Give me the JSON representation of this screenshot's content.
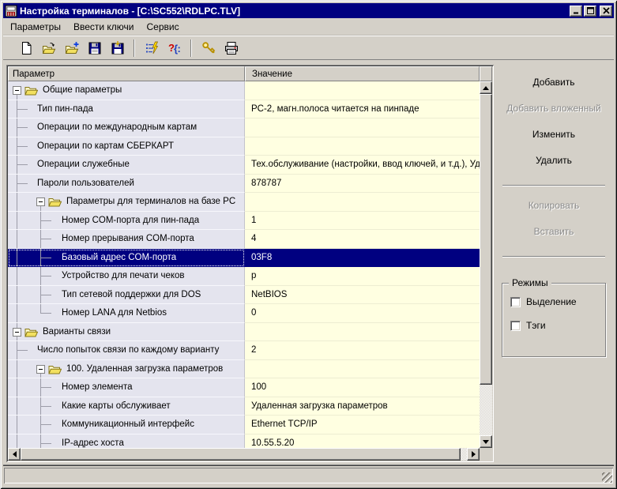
{
  "window": {
    "title": "Настройка терминалов - [C:\\SC552\\RDLPC.TLV]"
  },
  "menu": {
    "items": [
      "Параметры",
      "Ввести ключи",
      "Сервис"
    ]
  },
  "toolbar": {
    "buttons": [
      "new-file",
      "open-file",
      "open-file-add",
      "save-file",
      "save-file-as",
      "check-parameters",
      "syntax-help",
      "enter-keys",
      "print-device"
    ]
  },
  "table": {
    "columns": [
      "Параметр",
      "Значение"
    ],
    "rows": [
      {
        "label": "Общие параметры",
        "value": "",
        "kind": "folder",
        "pad": 44,
        "box": 6,
        "guides": [
          {
            "l": 11,
            "h": "bottom"
          }
        ]
      },
      {
        "label": "Тип пин-пада",
        "value": "PC-2, магн.полоса читается на пинпаде",
        "kind": "leaf",
        "pad": 37,
        "guides": [
          {
            "l": 11
          }
        ],
        "tick": 11
      },
      {
        "label": "Операции по международным картам",
        "value": "",
        "kind": "leaf",
        "pad": 37,
        "guides": [
          {
            "l": 11
          }
        ],
        "tick": 11
      },
      {
        "label": "Операции по картам СБЕРКАРТ",
        "value": "",
        "kind": "leaf",
        "pad": 37,
        "guides": [
          {
            "l": 11
          }
        ],
        "tick": 11
      },
      {
        "label": "Операции служебные",
        "value": "Тех.обслуживание (настройки, ввод ключей, и т.д.), Уд...",
        "kind": "leaf",
        "pad": 37,
        "guides": [
          {
            "l": 11
          }
        ],
        "tick": 11
      },
      {
        "label": "Пароли пользователей",
        "value": "878787",
        "kind": "leaf",
        "pad": 37,
        "guides": [
          {
            "l": 11
          }
        ],
        "tick": 11
      },
      {
        "label": "Параметры для терминалов на базе PC",
        "value": "",
        "kind": "folder",
        "pad": 74,
        "box": 36,
        "guides": [
          {
            "l": 11
          },
          {
            "l": 41,
            "h": "bottom"
          }
        ]
      },
      {
        "label": "Номер COM-порта для пин-пада",
        "value": "1",
        "kind": "leaf",
        "pad": 68,
        "guides": [
          {
            "l": 11
          },
          {
            "l": 41
          }
        ],
        "tick": 41
      },
      {
        "label": "Номер прерывания COM-порта",
        "value": "4",
        "kind": "leaf",
        "pad": 68,
        "guides": [
          {
            "l": 11
          },
          {
            "l": 41
          }
        ],
        "tick": 41
      },
      {
        "label": "Базовый адрес COM-порта",
        "value": "03F8",
        "kind": "leaf",
        "pad": 68,
        "guides": [
          {
            "l": 11
          },
          {
            "l": 41
          }
        ],
        "tick": 41,
        "selected": true
      },
      {
        "label": "Устройство для печати чеков",
        "value": "p",
        "kind": "leaf",
        "pad": 68,
        "guides": [
          {
            "l": 11
          },
          {
            "l": 41
          }
        ],
        "tick": 41
      },
      {
        "label": "Тип сетевой поддержки для DOS",
        "value": "NetBIOS",
        "kind": "leaf",
        "pad": 68,
        "guides": [
          {
            "l": 11
          },
          {
            "l": 41
          }
        ],
        "tick": 41
      },
      {
        "label": "Номер LANA для Netbios",
        "value": "0",
        "kind": "leaf",
        "pad": 68,
        "guides": [
          {
            "l": 11
          },
          {
            "l": 41,
            "h": "top"
          }
        ],
        "tick": 41
      },
      {
        "label": "Варианты связи",
        "value": "",
        "kind": "folder",
        "pad": 44,
        "box": 6,
        "guides": [
          {
            "l": 11
          }
        ]
      },
      {
        "label": "Число попыток связи по каждому варианту",
        "value": "2",
        "kind": "leaf",
        "pad": 37,
        "guides": [
          {
            "l": 11
          }
        ],
        "tick": 11
      },
      {
        "label": "100. Удаленная загрузка параметров",
        "value": "",
        "kind": "folder",
        "pad": 74,
        "box": 36,
        "guides": [
          {
            "l": 11
          },
          {
            "l": 41,
            "h": "bottom"
          }
        ]
      },
      {
        "label": "Номер элемента",
        "value": "100",
        "kind": "leaf",
        "pad": 68,
        "guides": [
          {
            "l": 11
          },
          {
            "l": 41
          }
        ],
        "tick": 41
      },
      {
        "label": "Какие карты обслуживает",
        "value": "Удаленная загрузка параметров",
        "kind": "leaf",
        "pad": 68,
        "guides": [
          {
            "l": 11
          },
          {
            "l": 41
          }
        ],
        "tick": 41
      },
      {
        "label": "Коммуникационный интерфейс",
        "value": "Ethernet TCP/IP",
        "kind": "leaf",
        "pad": 68,
        "guides": [
          {
            "l": 11
          },
          {
            "l": 41
          }
        ],
        "tick": 41
      },
      {
        "label": "IP-адрес хоста",
        "value": "10.55.5.20",
        "kind": "leaf",
        "pad": 68,
        "guides": [
          {
            "l": 11
          },
          {
            "l": 41
          }
        ],
        "tick": 41
      }
    ]
  },
  "side": {
    "buttons": [
      {
        "label": "Добавить",
        "enabled": true,
        "name": "add-button"
      },
      {
        "label": "Добавить вложенный",
        "enabled": false,
        "name": "add-nested-button"
      },
      {
        "label": "Изменить",
        "enabled": true,
        "name": "edit-button"
      },
      {
        "label": "Удалить",
        "enabled": true,
        "name": "delete-button"
      },
      {
        "divider": true
      },
      {
        "label": "Копировать",
        "enabled": false,
        "name": "copy-button"
      },
      {
        "label": "Вставить",
        "enabled": false,
        "name": "paste-button"
      },
      {
        "divider": true
      }
    ],
    "modes": {
      "title": "Режимы",
      "checkboxes": [
        {
          "label": "Выделение",
          "checked": false
        },
        {
          "label": "Тэги",
          "checked": false
        }
      ]
    }
  },
  "colors": {
    "titlebar": "#000080",
    "selection": "#000080",
    "param_bg": "#E4E4EE",
    "value_bg": "#FFFFE1",
    "chrome": "#D4D0C8"
  }
}
